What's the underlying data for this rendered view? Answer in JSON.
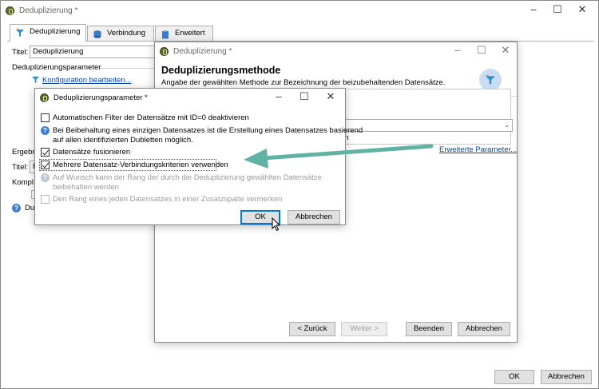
{
  "main": {
    "title": "Deduplizierung *",
    "tabs": [
      {
        "label": "Deduplizierung"
      },
      {
        "label": "Verbindung"
      },
      {
        "label": "Erweitert"
      }
    ],
    "titel_label": "Titel:",
    "titel_value": "Deduplizierung",
    "section_label": "Deduplizierungsparameter",
    "config_link": "Konfiguration bearbeiten...",
    "ergebn_label": "Ergebn",
    "titel2_label": "Titel:",
    "titel2_value": "E",
    "kompl_label": "Kompl",
    "du_label": "Du",
    "ok_label": "OK",
    "cancel_label": "Abbrechen"
  },
  "method_dialog": {
    "title": "Deduplizierung *",
    "heading": "Deduplizierungsmethode",
    "description": "Angabe der gewählten Methode zur Bezeichnung der beizubehaltenden Datensätze.",
    "combo_tail": "en",
    "advanced_link": "Erweiterte Parameter...",
    "back_label": "< Zurück",
    "next_label": "Weiter >",
    "finish_label": "Beenden",
    "cancel_label": "Abbrechen"
  },
  "params_dialog": {
    "title": "Deduplizierungsparameter *",
    "opt1_label": "Automatischen Filter der Datensätze mit ID=0 deaktivieren",
    "info_line1": "Bei Beibehaltung eines einzigen Datensatzes ist die Erstellung eines Datensatzes basierend",
    "info_line2": "auf allen identifizierten Dubletten möglich.",
    "opt2_label": "Datensätze fusionieren",
    "opt3_label": "Mehrere Datensatz-Verbindungskriterien verwenden",
    "hint_line1": "Auf Wunsch kann der Rang der durch die Deduplizierung gewählten Datensätze",
    "hint_line2": "beibehalten werden",
    "opt4_label": "Den Rang eines jeden Datensatzes in einer Zusatzspalte vermerken",
    "ok_label": "OK",
    "cancel_label": "Abbrechen",
    "options_state": {
      "opt1": false,
      "opt2": true,
      "opt3": true,
      "opt4": false
    }
  },
  "colors": {
    "arrow": "#5fb3a3",
    "link": "#0645ad",
    "focus": "#0078d7"
  }
}
